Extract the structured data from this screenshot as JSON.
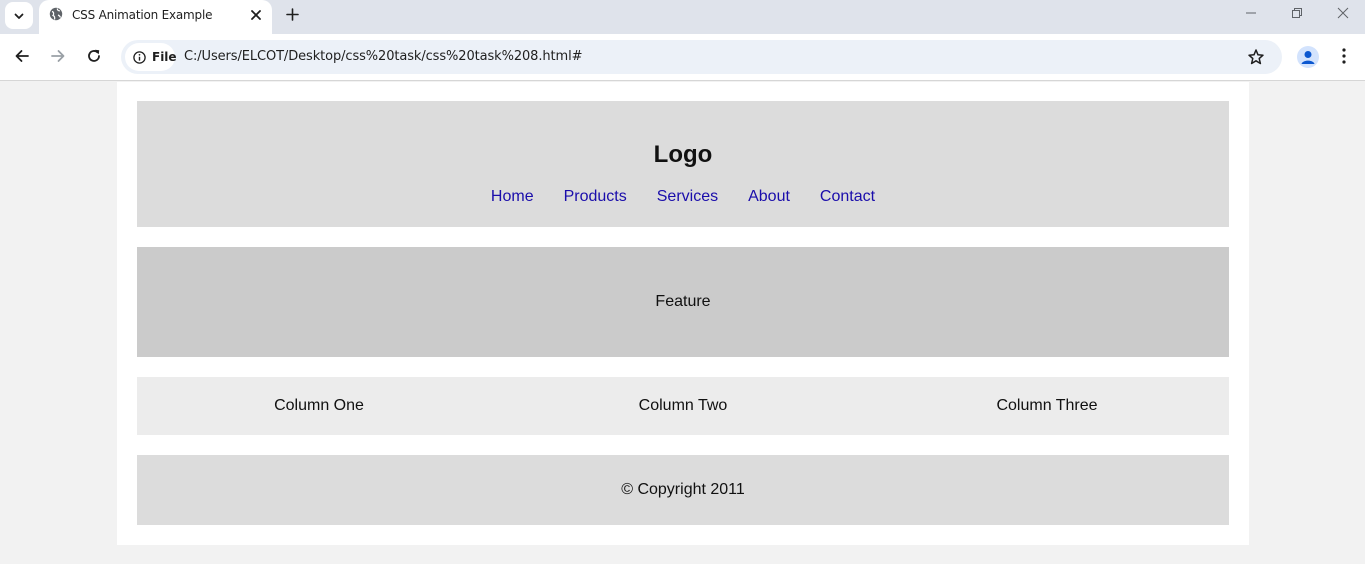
{
  "browser": {
    "tab": {
      "title": "CSS Animation Example"
    },
    "address": {
      "scheme_label": "File",
      "url": "C:/Users/ELCOT/Desktop/css%20task/css%20task%208.html#"
    }
  },
  "page": {
    "header": {
      "logo": "Logo",
      "nav": [
        "Home",
        "Products",
        "Services",
        "About",
        "Contact"
      ]
    },
    "feature": "Feature",
    "columns": [
      "Column One",
      "Column Two",
      "Column Three"
    ],
    "footer": "© Copyright 2011"
  },
  "icons": {
    "tab_search": "chevron-down-icon",
    "favicon": "globe-icon",
    "tab_close": "close-icon",
    "new_tab": "plus-icon",
    "back": "arrow-left-icon",
    "forward": "arrow-right-icon",
    "reload": "reload-icon",
    "site_info": "info-icon",
    "bookmark": "star-icon",
    "profile": "profile-icon",
    "menu": "kebab-icon"
  },
  "colors": {
    "link": "#1a0dab",
    "header_bg": "#dcdcdc",
    "feature_bg": "#cbcbcb",
    "columns_bg": "#ececec",
    "page_bg": "#f2f2f2"
  }
}
